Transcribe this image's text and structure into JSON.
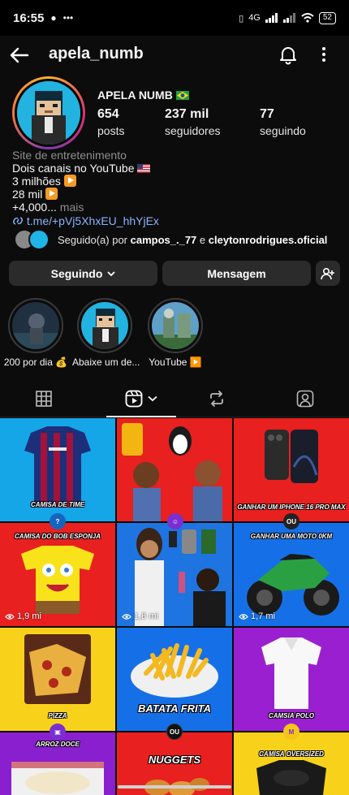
{
  "status_bar": {
    "time": "16:55",
    "network": "4G",
    "battery": "52"
  },
  "header": {
    "username": "apela_numb"
  },
  "profile": {
    "display_name": "APELA NUMB",
    "stats": [
      {
        "value": "654",
        "label": "posts"
      },
      {
        "value": "237 mil",
        "label": "seguidores"
      },
      {
        "value": "77",
        "label": "seguindo"
      }
    ],
    "category": "Site de entretenimento",
    "bio_lines": [
      "Dois canais no YouTube",
      "3 milhões",
      "28 mil",
      "+4,000..."
    ],
    "bio_more": "mais",
    "link": "t.me/+pVj5XhxEU_hhYjEx",
    "followed_prefix": "Seguido(a) por ",
    "followed_user1": "campos_._77",
    "followed_and": " e ",
    "followed_user2": "cleytonrodrigues.oficial"
  },
  "actions": {
    "following": "Seguindo",
    "message": "Mensagem"
  },
  "highlights": [
    {
      "label": "200 por dia 💰"
    },
    {
      "label": "Abaixe um de..."
    },
    {
      "label": "YouTube ▶️"
    }
  ],
  "grid": {
    "tile1": {
      "label": "CAMISA DE TIME"
    },
    "tile3": {
      "label": "GANHAR UM IPHONE 16 PRO MAX"
    },
    "tile4": {
      "label": "CAMISA DO BOB ESPONJA",
      "views": "1,9 mi"
    },
    "tile5": {
      "views": "1,8 mi"
    },
    "tile6": {
      "label": "GANHAR UMA MOTO 0KM",
      "views": "1,7 mi"
    },
    "tile7": {
      "label": "PIZZA"
    },
    "tile8": {
      "label": "BATATA FRITA"
    },
    "tile9": {
      "label": "CAMSIA POLO"
    },
    "tile10": {
      "label": "ARROZ DOCE"
    },
    "tile11": {
      "label": "NUGGETS"
    },
    "tile12": {
      "label": "CAMISA OVERSIZED"
    },
    "ou_label": "OU"
  },
  "colors": {
    "link": "#8ab4ff",
    "story_ring": "#e1306c",
    "button_bg": "#2b2b2b"
  }
}
